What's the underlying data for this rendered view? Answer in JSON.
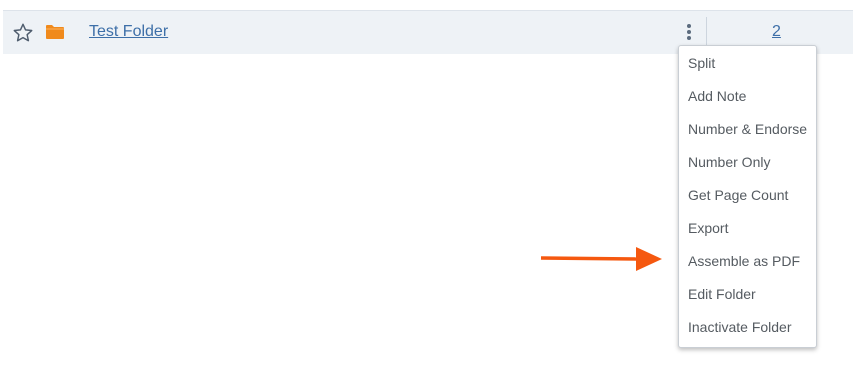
{
  "row": {
    "star_icon": "star-outline-icon",
    "folder_icon": "folder-icon",
    "folder_name": "Test Folder",
    "more_icon": "kebab-menu-icon",
    "count": "2"
  },
  "menu": {
    "items": [
      "Split",
      "Add Note",
      "Number & Endorse",
      "Number Only",
      "Get Page Count",
      "Export",
      "Assemble as PDF",
      "Edit Folder",
      "Inactivate Folder"
    ]
  },
  "annotation": {
    "arrow_icon": "arrow-right-icon",
    "arrow_color": "#f5580f",
    "points_to": "Assemble as PDF"
  },
  "colors": {
    "row_background": "#eef2f6",
    "link": "#3d6fa8",
    "folder": "#f08a1c",
    "menu_text": "#555b61"
  }
}
